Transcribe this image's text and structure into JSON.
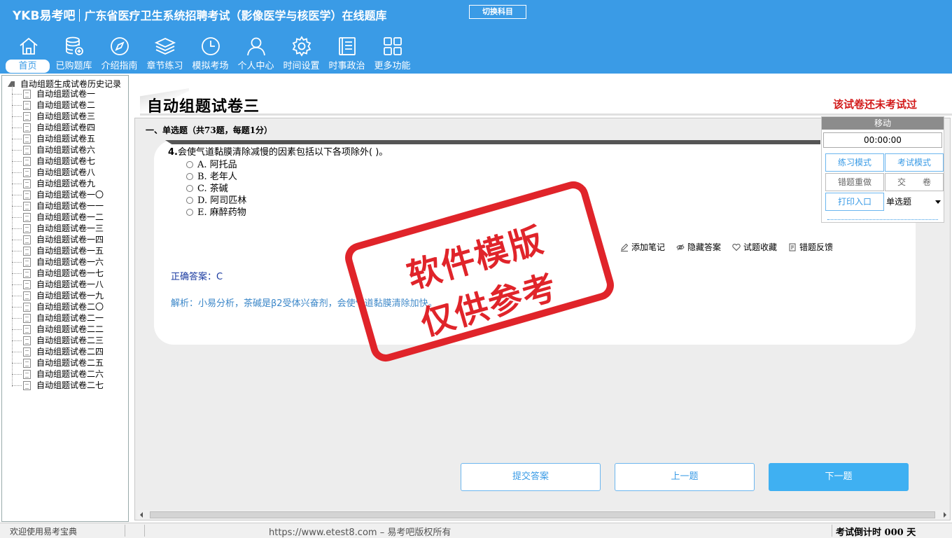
{
  "header": {
    "brand": "YKB易考吧",
    "title": "广东省医疗卫生系统招聘考试（影像医学与核医学）在线题库",
    "switch_label": "切换科目"
  },
  "nav": [
    {
      "label": "首页",
      "icon": "home-icon"
    },
    {
      "label": "已购题库",
      "icon": "database-icon"
    },
    {
      "label": "介绍指南",
      "icon": "compass-icon"
    },
    {
      "label": "章节练习",
      "icon": "layers-icon"
    },
    {
      "label": "模拟考场",
      "icon": "clock-icon"
    },
    {
      "label": "个人中心",
      "icon": "user-icon"
    },
    {
      "label": "时间设置",
      "icon": "gear-icon"
    },
    {
      "label": "时事政治",
      "icon": "news-icon"
    },
    {
      "label": "更多功能",
      "icon": "grid-icon"
    }
  ],
  "sidebar": {
    "root": "自动组题生成试卷历史记录",
    "items": [
      "自动组题试卷一",
      "自动组题试卷二",
      "自动组题试卷三",
      "自动组题试卷四",
      "自动组题试卷五",
      "自动组题试卷六",
      "自动组题试卷七",
      "自动组题试卷八",
      "自动组题试卷九",
      "自动组题试卷一〇",
      "自动组题试卷一一",
      "自动组题试卷一二",
      "自动组题试卷一三",
      "自动组题试卷一四",
      "自动组题试卷一五",
      "自动组题试卷一六",
      "自动组题试卷一七",
      "自动组题试卷一八",
      "自动组题试卷一九",
      "自动组题试卷二〇",
      "自动组题试卷二一",
      "自动组题试卷二二",
      "自动组题试卷二三",
      "自动组题试卷二四",
      "自动组题试卷二五",
      "自动组题试卷二六",
      "自动组题试卷二七"
    ]
  },
  "main": {
    "paper_title": "自动组题试卷三",
    "exam_status": "该试卷还未考试过",
    "section_header": "一、单选题（共73题，每题1分）",
    "question": {
      "number": "4.",
      "text": "会使气道黏膜清除减慢的因素包括以下各项除外( )。",
      "options": [
        "A. 阿托品",
        "B. 老年人",
        "C. 茶碱",
        "D. 阿司匹林",
        "E. 麻醉药物"
      ]
    },
    "tools": [
      {
        "label": "添加笔记",
        "icon": "pencil-icon"
      },
      {
        "label": "隐藏答案",
        "icon": "eye-icon"
      },
      {
        "label": "试题收藏",
        "icon": "heart-icon"
      },
      {
        "label": "错题反馈",
        "icon": "feedback-icon"
      }
    ],
    "answer": "正确答案：C",
    "analysis": "解析：小易分析，茶碱是β2受体兴奋剂，会使气道黏膜清除加快。",
    "stamp_line1": "软件模版",
    "stamp_line2": "仅供参考"
  },
  "panel": {
    "move_label": "移动",
    "timer": "00:00:00",
    "practice_mode": "练习模式",
    "exam_mode": "考试模式",
    "redo_wrong": "错题重做",
    "submit_paper": "交　　卷",
    "print_entry": "打印入口",
    "type_select": "单选题"
  },
  "buttons": {
    "submit_answer": "提交答案",
    "prev": "上一题",
    "next": "下一题"
  },
  "statusbar": {
    "welcome": "欢迎使用易考宝典",
    "copyright": "https://www.etest8.com – 易考吧版权所有",
    "countdown": "考试倒计时 000 天"
  },
  "colors": {
    "header_bg": "#3a9be6",
    "stamp_red": "#e0242a",
    "status_red": "#d21a1a",
    "primary_button": "#3fb0f2"
  }
}
